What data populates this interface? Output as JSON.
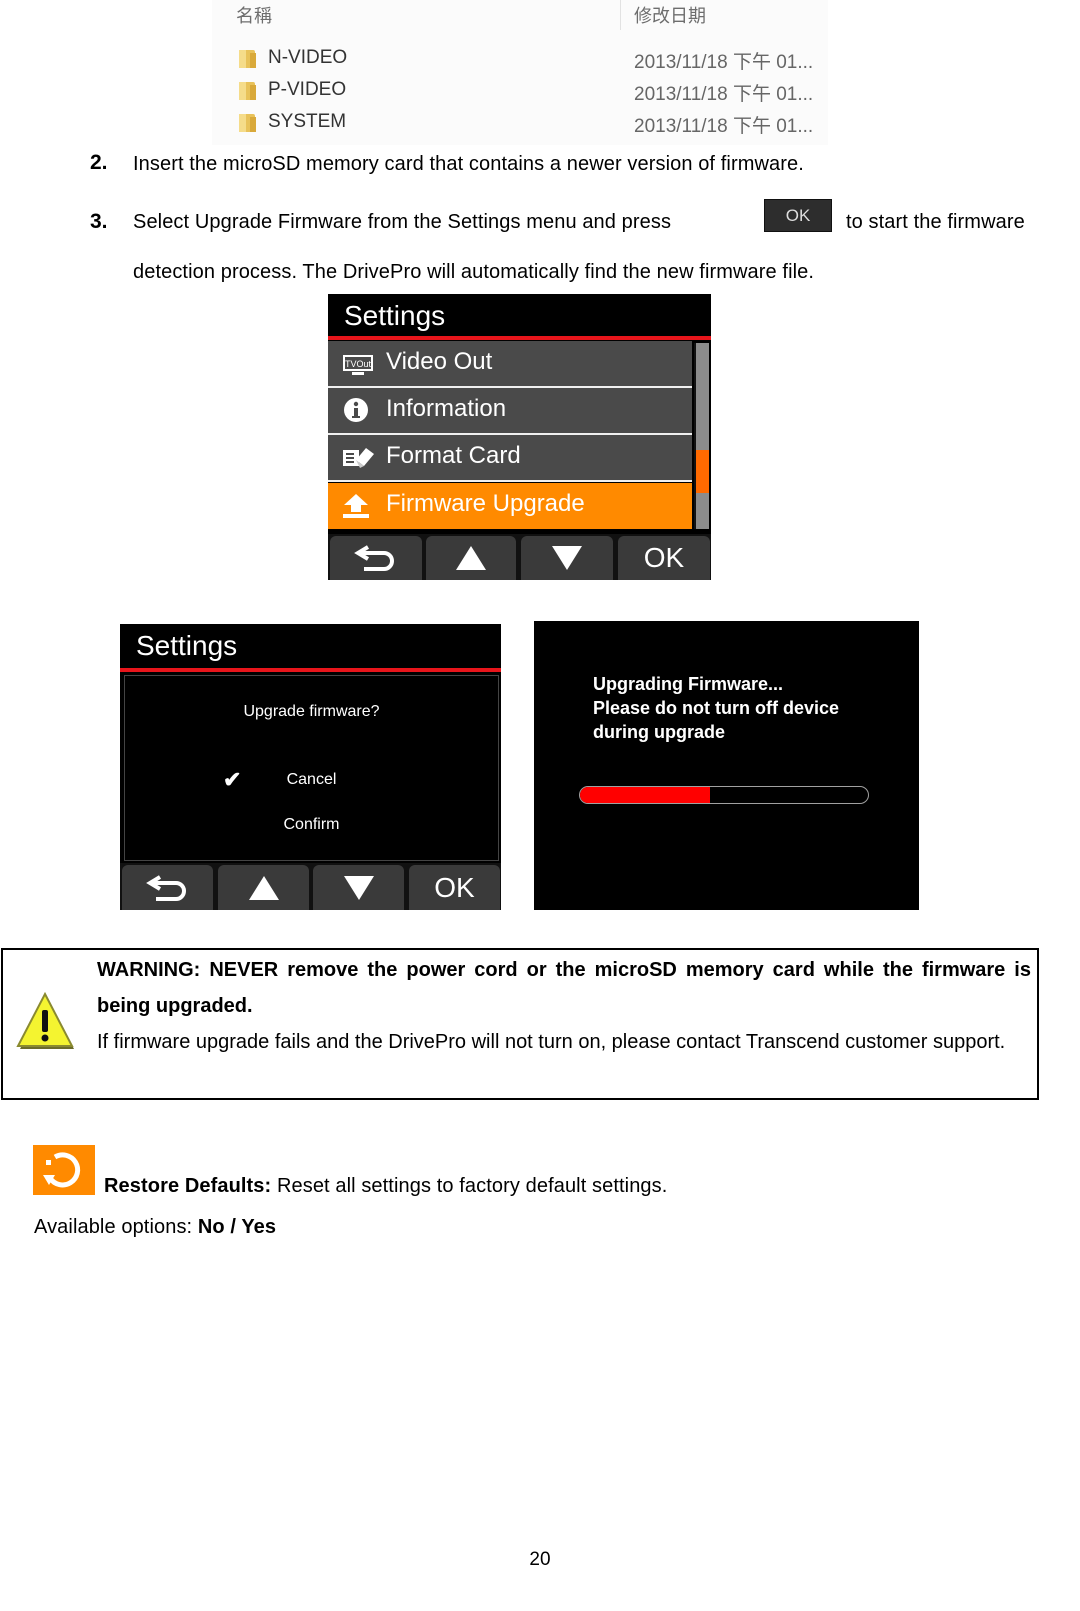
{
  "explorer": {
    "columns": {
      "name": "名稱",
      "modified": "修改日期"
    },
    "rows": [
      {
        "name": "N-VIDEO",
        "modified": "2013/11/18 下午 01..."
      },
      {
        "name": "P-VIDEO",
        "modified": "2013/11/18 下午 01..."
      },
      {
        "name": "SYSTEM",
        "modified": "2013/11/18 下午 01..."
      }
    ]
  },
  "steps": [
    {
      "num": "2.",
      "text": "Insert the microSD memory card that contains a newer version of firmware."
    },
    {
      "num": "3.",
      "text_before": "Select Upgrade Firmware from the Settings menu and press",
      "button": "OK",
      "text_after": "to start the firmware",
      "text_line2": "detection process. The DrivePro will automatically find the new firmware file."
    }
  ],
  "settings_menu": {
    "title": "Settings",
    "items": [
      {
        "icon": "tv-out-icon",
        "label": "Video Out",
        "active": false
      },
      {
        "icon": "info-icon",
        "label": "Information",
        "active": false
      },
      {
        "icon": "format-card-icon",
        "label": "Format Card",
        "active": false
      },
      {
        "icon": "upload-icon",
        "label": "Firmware Upgrade",
        "active": true
      }
    ],
    "buttons": {
      "back": "back-icon",
      "up": "up-arrow-icon",
      "down": "down-arrow-icon",
      "ok": "OK"
    }
  },
  "confirm_dialog": {
    "title": "Settings",
    "question": "Upgrade firmware?",
    "options": [
      {
        "label": "Cancel",
        "selected": true
      },
      {
        "label": "Confirm",
        "selected": false
      }
    ],
    "check_glyph": "✔",
    "buttons": {
      "ok": "OK"
    }
  },
  "progress_screen": {
    "line1": "Upgrading Firmware...",
    "line2": "Please do not turn off device",
    "line3": "during upgrade",
    "progress_percent": 45
  },
  "warning": {
    "bold_text": "WARNING: NEVER remove the power cord or the microSD memory card while the firmware is being upgraded.",
    "text": "If firmware upgrade fails and the DrivePro will not turn on, please contact Transcend customer support."
  },
  "restore": {
    "title": "Restore Defaults:",
    "description": " Reset all settings to factory default settings.",
    "options_label": "Available options: ",
    "options_value": "No / Yes"
  },
  "colors": {
    "accent_orange": "#ff8a00",
    "red": "#e8151b",
    "progress_red": "#ff0000"
  },
  "page_number": "20"
}
